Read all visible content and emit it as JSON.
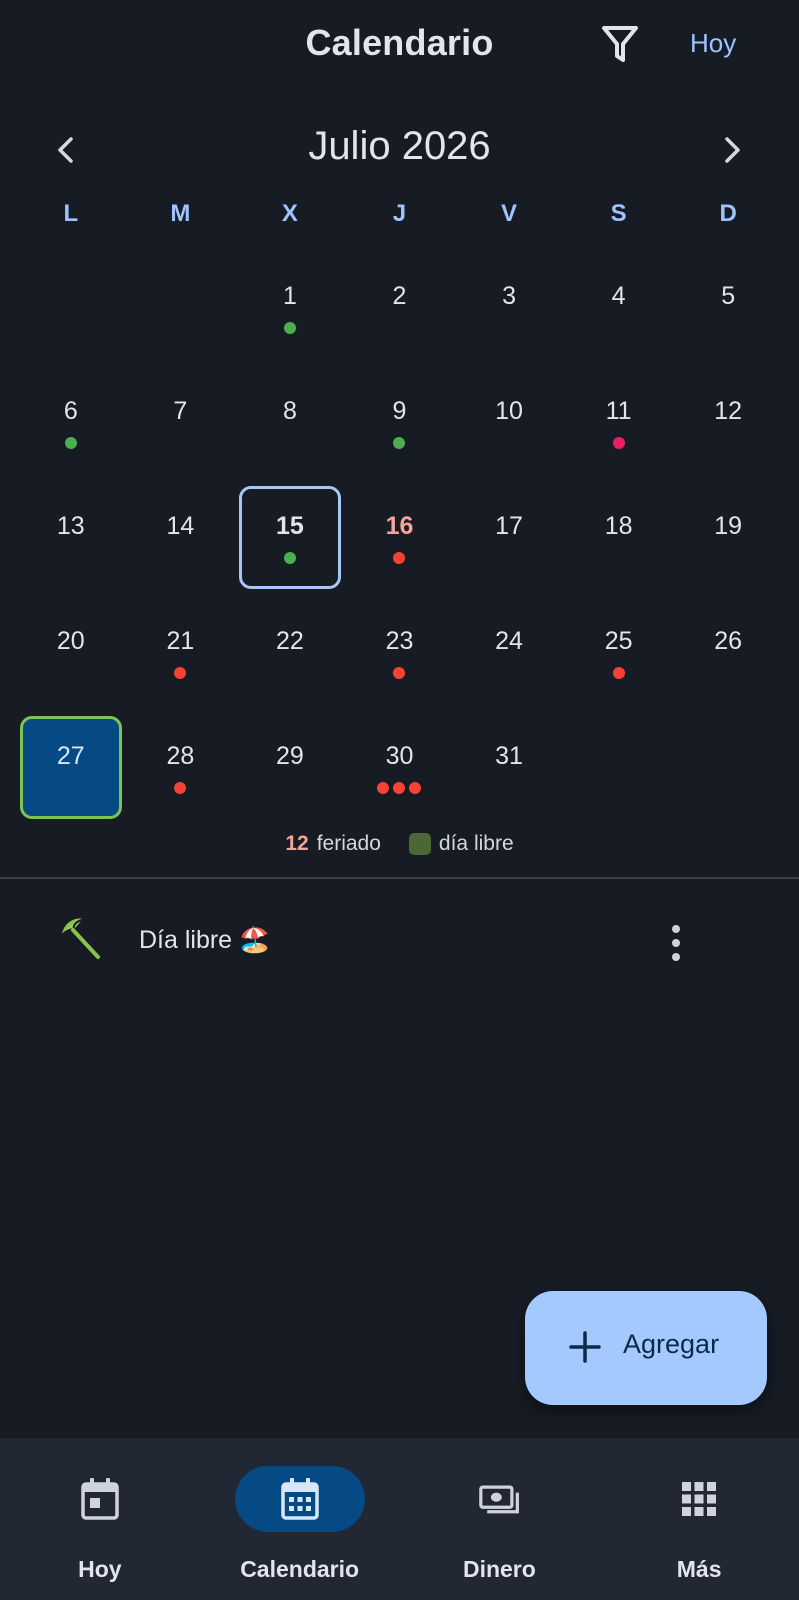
{
  "header": {
    "title": "Calendario",
    "filter_icon": "filter-icon",
    "today_label": "Hoy"
  },
  "month": {
    "title": "Julio 2026",
    "prev_icon": "chevron-left-icon",
    "next_icon": "chevron-right-icon"
  },
  "weekdays": [
    "L",
    "M",
    "X",
    "J",
    "V",
    "S",
    "D"
  ],
  "weeks": [
    [
      {
        "day": ""
      },
      {
        "day": ""
      },
      {
        "day": "1",
        "dots": [
          "green"
        ]
      },
      {
        "day": "2"
      },
      {
        "day": "3"
      },
      {
        "day": "4"
      },
      {
        "day": "5"
      }
    ],
    [
      {
        "day": "6",
        "dots": [
          "green"
        ]
      },
      {
        "day": "7"
      },
      {
        "day": "8"
      },
      {
        "day": "9",
        "dots": [
          "green"
        ]
      },
      {
        "day": "10"
      },
      {
        "day": "11",
        "dots": [
          "pink"
        ]
      },
      {
        "day": "12"
      }
    ],
    [
      {
        "day": "13"
      },
      {
        "day": "14"
      },
      {
        "day": "15",
        "dots": [
          "green"
        ],
        "state": "today"
      },
      {
        "day": "16",
        "dots": [
          "red"
        ],
        "state": "holiday"
      },
      {
        "day": "17"
      },
      {
        "day": "18"
      },
      {
        "day": "19"
      }
    ],
    [
      {
        "day": "20"
      },
      {
        "day": "21",
        "dots": [
          "red"
        ]
      },
      {
        "day": "22"
      },
      {
        "day": "23",
        "dots": [
          "red"
        ]
      },
      {
        "day": "24"
      },
      {
        "day": "25",
        "dots": [
          "red"
        ]
      },
      {
        "day": "26"
      }
    ],
    [
      {
        "day": "27",
        "state": "selected"
      },
      {
        "day": "28",
        "dots": [
          "red"
        ]
      },
      {
        "day": "29"
      },
      {
        "day": "30",
        "dots": [
          "red",
          "red",
          "red"
        ]
      },
      {
        "day": "31"
      },
      {
        "day": ""
      },
      {
        "day": ""
      }
    ]
  ],
  "legend": {
    "holiday_count": "12",
    "holiday_label": "feriado",
    "free_day_label": "día libre",
    "free_day_color": "#4b6637"
  },
  "event": {
    "icon": "beach-umbrella-icon",
    "title": "Día libre",
    "emoji": "🏖️",
    "menu_icon": "more-vert-icon"
  },
  "fab": {
    "icon": "plus-icon",
    "label": "Agregar"
  },
  "bottom_nav": [
    {
      "label": "Hoy",
      "icon": "today-icon",
      "active": false
    },
    {
      "label": "Calendario",
      "icon": "calendar-month-icon",
      "active": true
    },
    {
      "label": "Dinero",
      "icon": "money-icon",
      "active": false
    },
    {
      "label": "Más",
      "icon": "apps-grid-icon",
      "active": false
    }
  ],
  "colors": {
    "background": "#171b24",
    "accent": "#9ec4ff",
    "fab": "#a4c9fe",
    "selected_fill": "#054a84",
    "selected_border": "#7fc256",
    "today_border": "#a7c8f7",
    "holiday_text": "#f7a39c",
    "dot_green": "#4caf50",
    "dot_red": "#f44336",
    "dot_pink": "#e91e63"
  }
}
